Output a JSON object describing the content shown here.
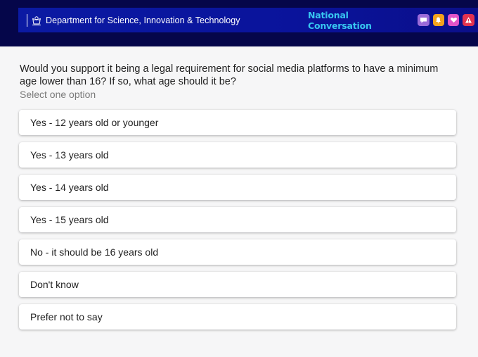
{
  "header": {
    "department": "Department for Science, Innovation & Technology",
    "title": "National Conversation",
    "icons": [
      {
        "name": "chat-bubble-icon",
        "color": "#9b6bd9"
      },
      {
        "name": "bell-icon",
        "color": "#f3a21c"
      },
      {
        "name": "heart-icon",
        "color": "#e254c9"
      },
      {
        "name": "alert-icon",
        "color": "#e2324f"
      }
    ],
    "colors": {
      "bar": "#05064a",
      "banner": "#0b1aa3",
      "title": "#37c6f0"
    }
  },
  "question": {
    "text": "Would you support it being a legal requirement for social media platforms to have a minimum age lower than 16? If so, what age should it be?",
    "hint": "Select one option"
  },
  "options": [
    "Yes - 12 years old or younger",
    "Yes - 13 years old",
    "Yes - 14 years old",
    "Yes - 15 years old",
    "No - it should be 16 years old",
    "Don't know",
    "Prefer not to say"
  ]
}
